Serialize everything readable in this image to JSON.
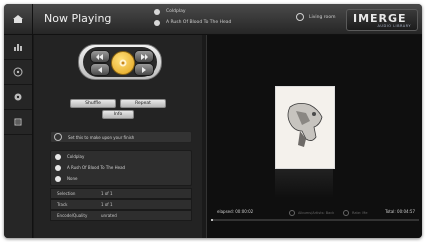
{
  "header": {
    "title": "Now Playing",
    "now_playing_artist": "Coldplay",
    "now_playing_title": "A Rush Of Blood To The Head",
    "status_text": "Living room",
    "logo_text": "IMERGE",
    "logo_subtext": "AUDIO LIBRARY"
  },
  "sidebar": {
    "items": [
      {
        "icon": "home-icon"
      },
      {
        "icon": "bar-chart-icon"
      },
      {
        "icon": "disc-icon"
      },
      {
        "icon": "settings-icon"
      },
      {
        "icon": "list-icon"
      }
    ]
  },
  "controls": {
    "shuffle_label": "Shuffle",
    "repeat_label": "Repeat",
    "info_label": "Info",
    "accent_color": "#e2a31d"
  },
  "playlist": {
    "label": "Set this to make upon your finish"
  },
  "track_info": {
    "artist": "Coldplay",
    "album": "A Rush Of Blood To The Head",
    "track": "None"
  },
  "details": [
    {
      "key": "Selection",
      "value": "1 of 1"
    },
    {
      "key": "Track",
      "value": "1 of 1"
    },
    {
      "key": "Encode/Quality",
      "value": "unrated"
    }
  ],
  "player": {
    "elapsed": "elapsed: 00:00:02",
    "mini_left": "Albums/Artists: Back",
    "mini_right": "Rate: Me",
    "total": "Total: 00:04:57",
    "progress": 0.01
  }
}
